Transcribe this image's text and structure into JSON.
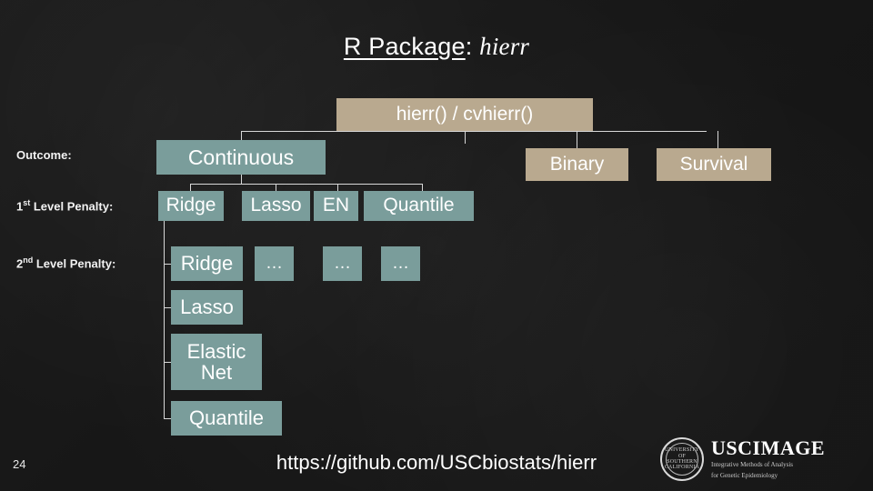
{
  "slide": {
    "title": {
      "prefix": "R Package",
      "separator": ": ",
      "package": "hierr"
    },
    "page_number": "24",
    "footer_link": "https://github.com/USCbiostats/hierr",
    "row_labels": {
      "outcome": "Outcome:",
      "first_penalty_pre": "1",
      "first_penalty_sup": "st",
      "first_penalty_post": " Level Penalty:",
      "second_penalty_pre": "2",
      "second_penalty_sup": "nd",
      "second_penalty_post": " Level Penalty:"
    },
    "root": {
      "label": "hierr() / cvhierr()",
      "color": "#b9a98f"
    },
    "outcomes": [
      {
        "label": "Continuous",
        "color": "#7a9d9b"
      },
      {
        "label": "Binary",
        "color": "#b9a98f"
      },
      {
        "label": "Survival",
        "color": "#b9a98f"
      }
    ],
    "first_level_penalties": [
      {
        "label": "Ridge",
        "color": "#7a9d9b"
      },
      {
        "label": "Lasso",
        "color": "#7a9d9b"
      },
      {
        "label": "EN",
        "color": "#7a9d9b"
      },
      {
        "label": "Quantile",
        "color": "#7a9d9b"
      }
    ],
    "second_level_penalties": [
      {
        "label": "Ridge",
        "color": "#7a9d9b"
      },
      {
        "label": "Lasso",
        "color": "#7a9d9b"
      },
      {
        "label": "Elastic Net",
        "color": "#7a9d9b"
      },
      {
        "label": "Quantile",
        "color": "#7a9d9b"
      }
    ],
    "second_level_ellipses": [
      {
        "label": "…",
        "color": "#7a9d9b"
      },
      {
        "label": "…",
        "color": "#7a9d9b"
      },
      {
        "label": "…",
        "color": "#7a9d9b"
      }
    ],
    "logo": {
      "seal_text": "UNIVERSITY OF SOUTHERN CALIFORNIA",
      "main_usc": "USC",
      "main_image": "IMAGE",
      "sub_line1": "Integrative Methods of Analysis",
      "sub_line2": "for Genetic Epidemiology"
    }
  }
}
